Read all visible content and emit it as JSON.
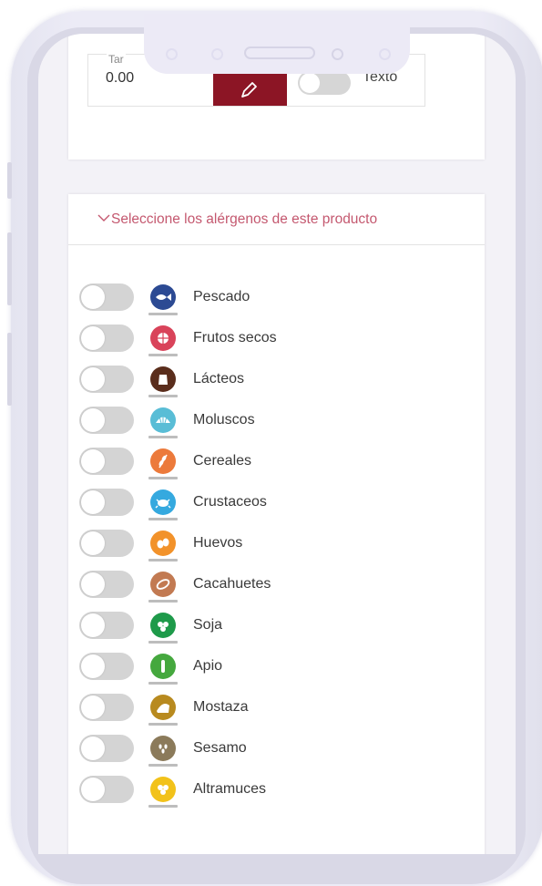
{
  "form": {
    "amount_label": "Tar",
    "amount_value": "0.00",
    "text_toggle_label": "Texto"
  },
  "allergens_section": {
    "title": "Seleccione los alérgenos de este producto",
    "items": [
      {
        "label": "Pescado",
        "icon": "fish-icon",
        "color": "#2c4a93"
      },
      {
        "label": "Frutos secos",
        "icon": "nuts-icon",
        "color": "#d9435a"
      },
      {
        "label": "Lácteos",
        "icon": "milk-icon",
        "color": "#5a2d1c"
      },
      {
        "label": "Moluscos",
        "icon": "shell-icon",
        "color": "#59bdd6"
      },
      {
        "label": "Cereales",
        "icon": "wheat-icon",
        "color": "#ec7a3b"
      },
      {
        "label": "Crustaceos",
        "icon": "crab-icon",
        "color": "#35a9df"
      },
      {
        "label": "Huevos",
        "icon": "eggs-icon",
        "color": "#f2922a"
      },
      {
        "label": "Cacahuetes",
        "icon": "peanut-icon",
        "color": "#c27a52"
      },
      {
        "label": "Soja",
        "icon": "soy-icon",
        "color": "#1e9a4a"
      },
      {
        "label": "Apio",
        "icon": "celery-icon",
        "color": "#45a83e"
      },
      {
        "label": "Mostaza",
        "icon": "mustard-icon",
        "color": "#b88a1f"
      },
      {
        "label": "Sesamo",
        "icon": "sesame-icon",
        "color": "#8b7a5a"
      },
      {
        "label": "Altramuces",
        "icon": "lupin-icon",
        "color": "#f2c21a"
      }
    ]
  },
  "colors": {
    "accent": "#c4586f",
    "edit_button": "#8c1525",
    "toggle_off": "#d4d4d4"
  }
}
